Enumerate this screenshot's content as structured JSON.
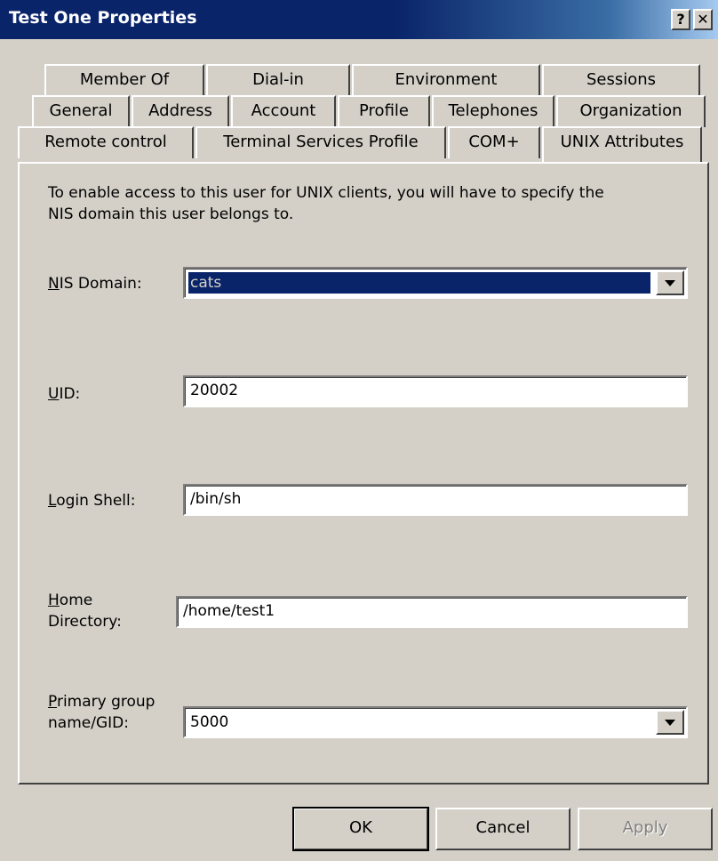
{
  "window": {
    "title": "Test One Properties",
    "help_button": "?",
    "close_button": "✕"
  },
  "tabs": {
    "row1": [
      "Member Of",
      "Dial-in",
      "Environment",
      "Sessions"
    ],
    "row2": [
      "General",
      "Address",
      "Account",
      "Profile",
      "Telephones",
      "Organization"
    ],
    "row3": [
      "Remote control",
      "Terminal Services Profile",
      "COM+",
      "UNIX Attributes"
    ],
    "active": "UNIX Attributes"
  },
  "panel": {
    "intro_line1": "To enable access to this user for UNIX clients, you will have to specify the",
    "intro_line2": "NIS domain this user belongs to.",
    "nis_domain": {
      "label_ul": "N",
      "label_rest": "IS Domain:",
      "value": "cats"
    },
    "uid": {
      "label_ul": "U",
      "label_rest": "ID:",
      "value": "20002"
    },
    "login_shell": {
      "label_ul": "L",
      "label_rest": "ogin Shell:",
      "value": "/bin/sh"
    },
    "home_directory": {
      "label_line1_ul": "H",
      "label_line1_rest": "ome",
      "label_line2": "Directory:",
      "value": "/home/test1"
    },
    "primary_group": {
      "label_line1_ul": "P",
      "label_line1_rest": "rimary group",
      "label_line2": "name/GID:",
      "value": "5000"
    }
  },
  "buttons": {
    "ok": "OK",
    "cancel": "Cancel",
    "apply": "Apply"
  },
  "colors": {
    "title_bar": "#0a246a",
    "dialog_bg": "#d4d0c8",
    "selection": "#0a246a"
  }
}
